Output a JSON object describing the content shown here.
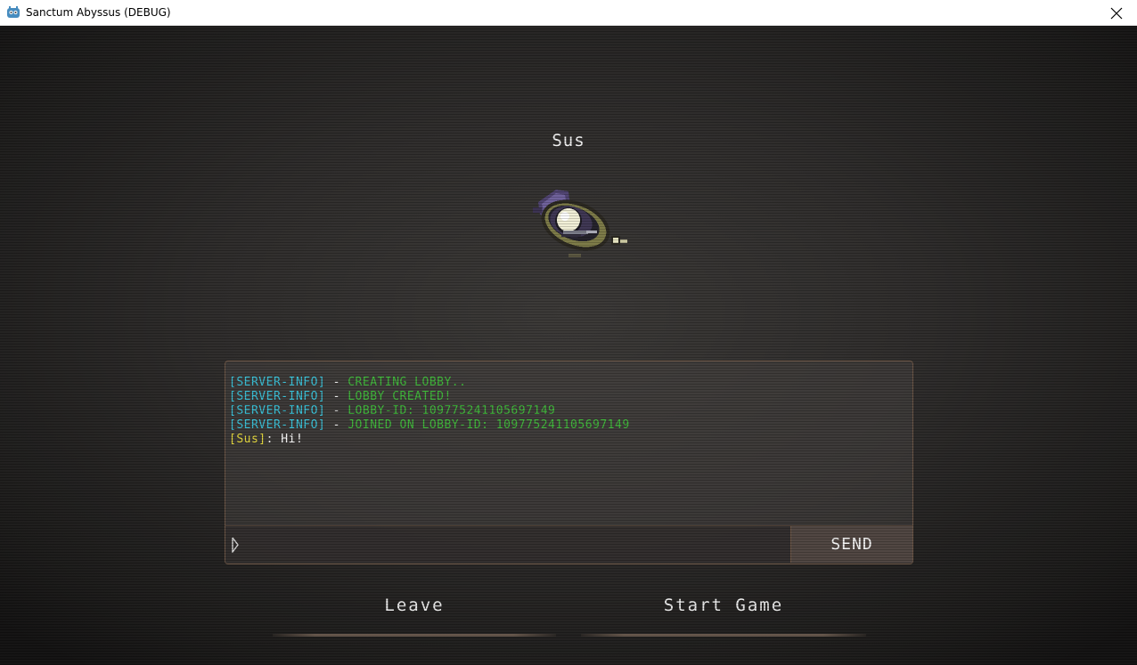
{
  "window": {
    "title": "Sanctum Abyssus (DEBUG)",
    "app_icon": "godot-icon",
    "close_icon": "close-icon"
  },
  "lobby": {
    "player_name": "Sus",
    "player_sprite": "eye-creature-sprite"
  },
  "chat": {
    "lines": [
      {
        "tag": "[SERVER-INFO]",
        "sep": " - ",
        "text": "CREATING LOBBY.."
      },
      {
        "tag": "[SERVER-INFO]",
        "sep": " - ",
        "text": "LOBBY CREATED!"
      },
      {
        "tag": "[SERVER-INFO]",
        "sep": " - ",
        "text": "LOBBY-ID: 109775241105697149"
      },
      {
        "tag": "[SERVER-INFO]",
        "sep": " - ",
        "text": "JOINED ON LOBBY-ID: 109775241105697149"
      },
      {
        "tag": "[Sus]",
        "sep": ": ",
        "text": "Hi!"
      }
    ],
    "input_value": "",
    "send_label": "SEND"
  },
  "buttons": {
    "leave_label": "Leave",
    "start_label": "Start Game"
  },
  "colors": {
    "server_tag": "#39c1d8",
    "server_msg": "#3fb83a",
    "user_tag": "#e6d93c",
    "user_msg": "#ffffff",
    "panel_border": "#6b5444"
  }
}
